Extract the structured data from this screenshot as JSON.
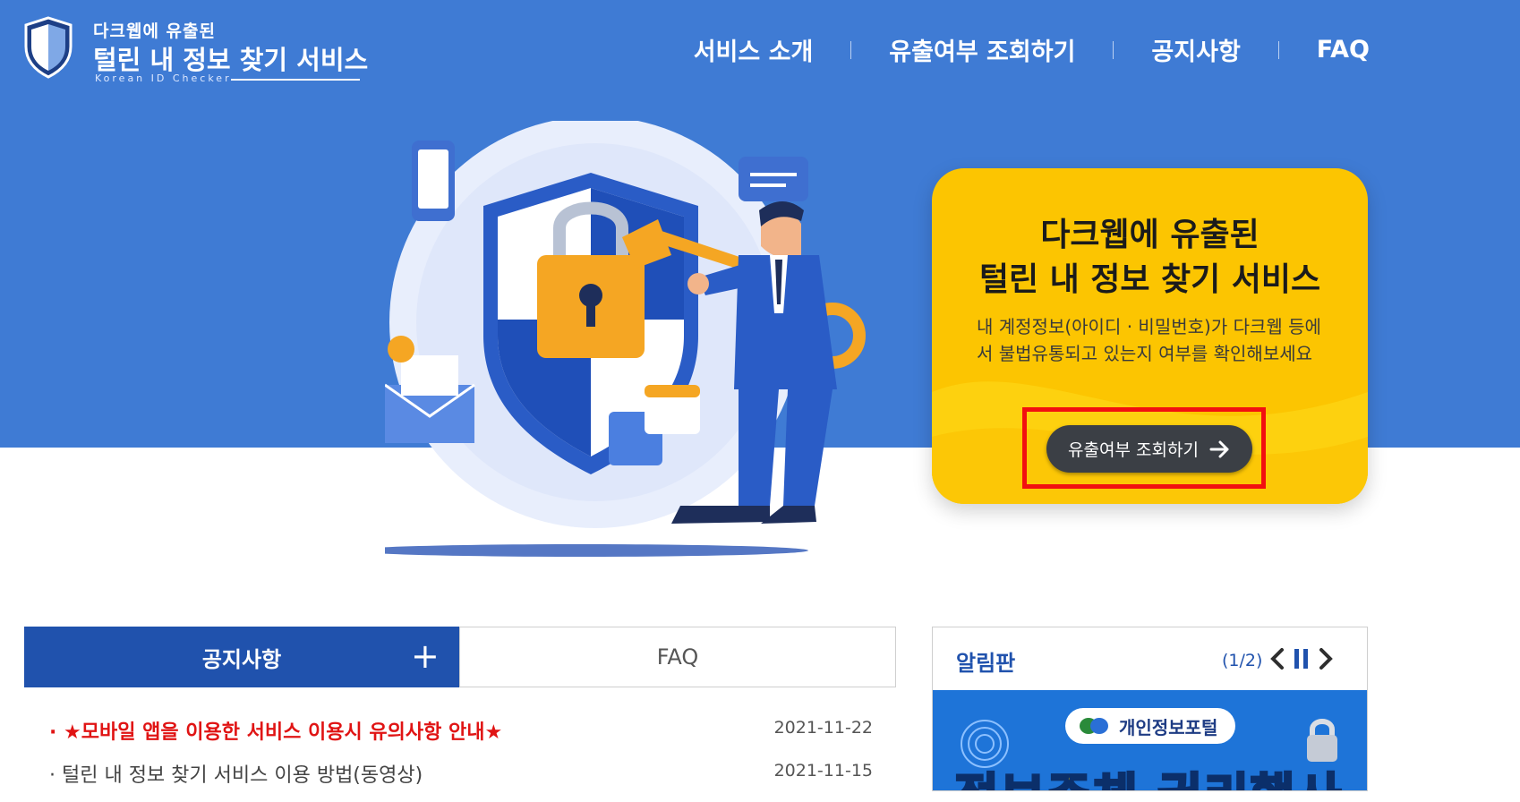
{
  "header": {
    "logo_line1": "다크웹에 유출된",
    "logo_line2": "털린 내 정보 찾기 서비스",
    "logo_sub": "Korean ID Checker",
    "nav": [
      "서비스 소개",
      "유출여부 조회하기",
      "공지사항",
      "FAQ"
    ]
  },
  "hero": {
    "card_title_1": "다크웹에 유출된",
    "card_title_2": "털린 내 정보 찾기 서비스",
    "card_desc": "내 계정정보(아이디 · 비밀번호)가 다크웹 등에서 불법유통되고 있는지 여부를 확인해보세요",
    "cta_label": "유출여부 조회하기",
    "cta_icon": "arrow-right-icon"
  },
  "tabs": {
    "notice_label": "공지사항",
    "faq_label": "FAQ",
    "more_icon": "plus-icon"
  },
  "notices": [
    {
      "title": "· ★모바일 앱을 이용한 서비스 이용시 유의사항 안내★",
      "date": "2021-11-22"
    },
    {
      "title": "· 털린 내 정보 찾기 서비스 이용 방법(동영상)",
      "date": "2021-11-15"
    }
  ],
  "board": {
    "title": "알림판",
    "page_indicator": "(1/2)",
    "banner_pill_text": "개인정보포털",
    "banner_big_text": "정보주체 권리행사"
  },
  "colors": {
    "primary": "#3f7bd4",
    "tab_active": "#2052ad",
    "card_yellow": "#fcc501",
    "highlight": "#f21010",
    "notice_hot": "#e01414"
  }
}
